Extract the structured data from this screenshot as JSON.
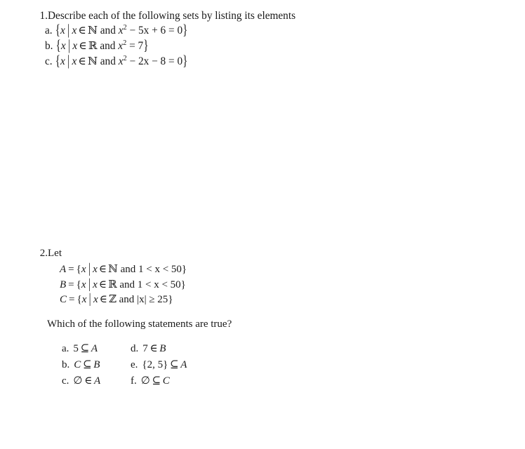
{
  "document": {
    "background_color": "#ffffff",
    "text_color": "#1a1a1a"
  },
  "problems": [
    {
      "number": "1.",
      "statement": "Describe each of the following sets by listing its elements",
      "subitems": [
        {
          "label": "a.",
          "text": "{x | x ∈ ℕ and x² − 5x + 6 = 0}",
          "open_brace": "{",
          "var": "x",
          "divider": "|",
          "var2": "x",
          "member_op": "∈",
          "set_symbol": "ℕ",
          "conj": "and",
          "expr_var": "x",
          "expr_exp": "2",
          "expr_rest": "− 5x + 6 = 0",
          "close_brace": "}"
        },
        {
          "label": "b.",
          "text": "{x | x ∈ ℝ and x² = 7}",
          "open_brace": "{",
          "var": "x",
          "divider": "|",
          "var2": "x",
          "member_op": "∈",
          "set_symbol": "ℝ",
          "conj": "and",
          "expr_var": "x",
          "expr_exp": "2",
          "expr_rest": "= 7",
          "close_brace": "}"
        },
        {
          "label": "c.",
          "text": "{x | x ∈ ℕ and x² − 2x − 8 = 0}",
          "open_brace": "{",
          "var": "x",
          "divider": "|",
          "var2": "x",
          "member_op": "∈",
          "set_symbol": "ℕ",
          "conj": "and",
          "expr_var": "x",
          "expr_exp": "2",
          "expr_rest": "− 2x − 8 = 0",
          "close_brace": "}"
        }
      ]
    },
    {
      "number": "2.",
      "statement": "Let",
      "definitions": [
        {
          "name": "A",
          "equals": "=",
          "open_brace": "{",
          "var": "x",
          "divider": "|",
          "var2": "x",
          "member_op": "∈",
          "set_symbol": "ℕ",
          "conj": "and",
          "condition": "1 < x < 50",
          "close_brace": "}",
          "text": "A = {x | x ∈ ℕ and 1 < x < 50}"
        },
        {
          "name": "B",
          "equals": "=",
          "open_brace": "{",
          "var": "x",
          "divider": "|",
          "var2": "x",
          "member_op": "∈",
          "set_symbol": "ℝ",
          "conj": "and",
          "condition": "1 < x < 50",
          "close_brace": "}",
          "text": "B = {x | x ∈ ℝ and 1 < x < 50}"
        },
        {
          "name": "C",
          "equals": "=",
          "open_brace": "{",
          "var": "x",
          "divider": "|",
          "var2": "x",
          "member_op": "∈",
          "set_symbol": "ℤ",
          "conj": "and",
          "condition": "|x| ≥ 25",
          "close_brace": "}",
          "text": "C = {x | x ∈ ℤ and |x| ≥ 25}"
        }
      ],
      "question": "Which of the following statements are true?",
      "options": [
        {
          "label": "a.",
          "left": "5",
          "relation": "⊆",
          "right": "A",
          "text": "5 ⊆ A"
        },
        {
          "label": "d.",
          "left": "7",
          "relation": "∈",
          "right": "B",
          "text": "7 ∈ B"
        },
        {
          "label": "b.",
          "left": "C",
          "relation": "⊆",
          "right": "B",
          "text": "C ⊆ B"
        },
        {
          "label": "e.",
          "left": "{2, 5}",
          "relation": "⊆",
          "right": "A",
          "text": "{2, 5} ⊆ A"
        },
        {
          "label": "c.",
          "left": "∅",
          "relation": "∈",
          "right": "A",
          "text": "∅ ∈ A"
        },
        {
          "label": "f.",
          "left": "∅",
          "relation": "⊆",
          "right": "C",
          "text": "∅ ⊆ C"
        }
      ]
    }
  ]
}
